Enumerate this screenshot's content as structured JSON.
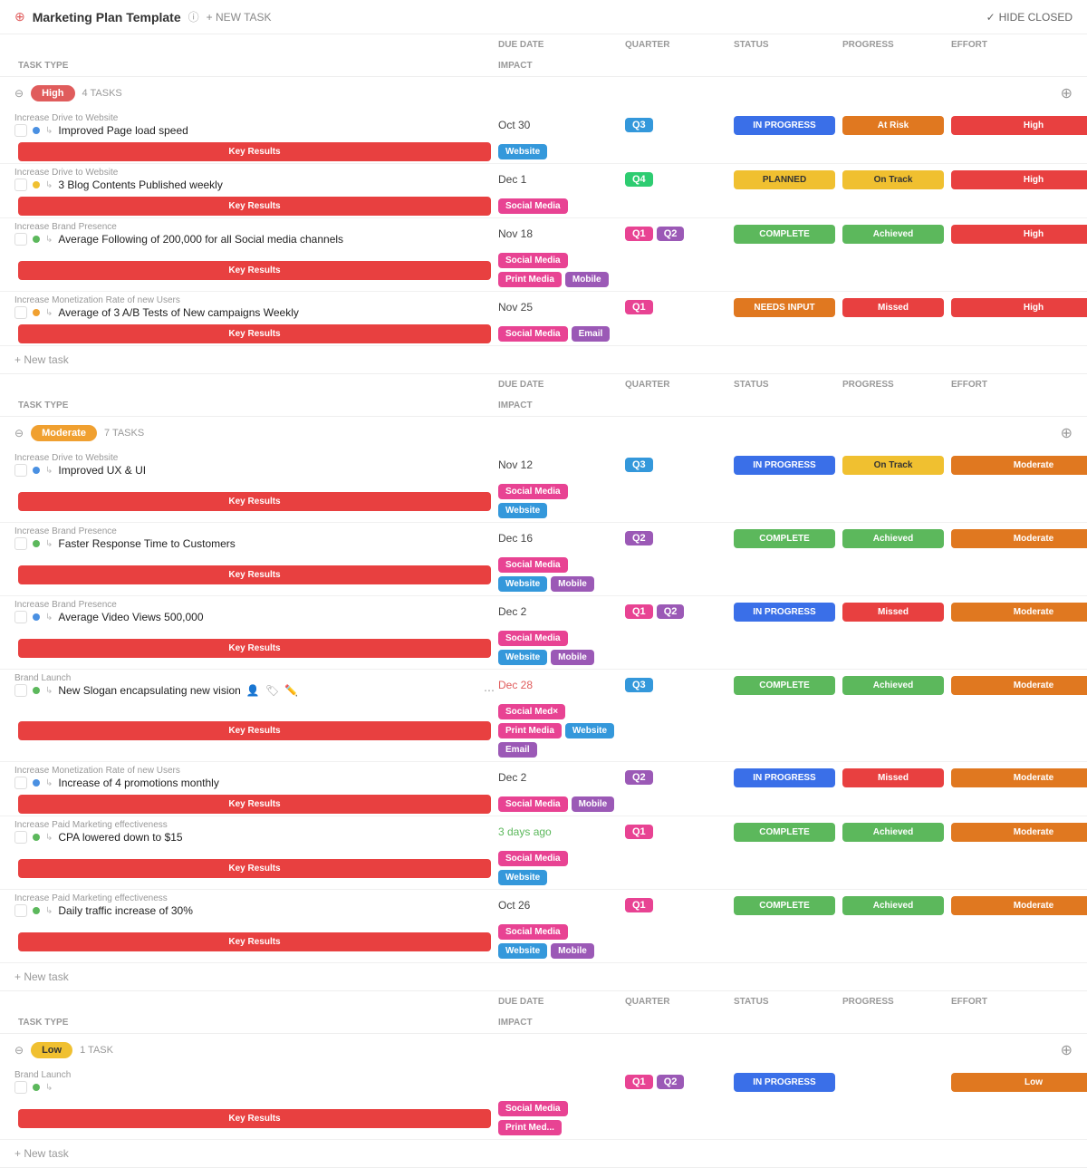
{
  "header": {
    "title": "Marketing Plan Template",
    "new_task": "+ NEW TASK",
    "hide_closed": "✓ HIDE CLOSED"
  },
  "columns": [
    "DUE DATE",
    "QUARTER",
    "STATUS",
    "PROGRESS",
    "EFFORT",
    "TASK TYPE",
    "IMPACT"
  ],
  "groups": [
    {
      "id": "high",
      "label": "High",
      "badge_class": "badge-high",
      "count": "4 TASKS",
      "tasks": [
        {
          "category": "Increase Drive to Website",
          "name": "Improved Page load speed",
          "priority": "blue",
          "due": "Oct 30",
          "quarters": [
            "Q3"
          ],
          "quarter_classes": [
            "q3"
          ],
          "status": "IN PROGRESS",
          "status_class": "status-in-progress",
          "progress": "At Risk",
          "progress_class": "prog-at-risk",
          "effort": "High",
          "effort_class": "effort-high",
          "task_type": "Key Results",
          "impact": [
            {
              "label": "Website",
              "class": "tag-website"
            }
          ]
        },
        {
          "category": "Increase Drive to Website",
          "name": "3 Blog Contents Published weekly",
          "priority": "yellow",
          "due": "Dec 1",
          "quarters": [
            "Q4"
          ],
          "quarter_classes": [
            "q4"
          ],
          "status": "PLANNED",
          "status_class": "status-planned",
          "progress": "On Track",
          "progress_class": "prog-on-track",
          "effort": "High",
          "effort_class": "effort-high",
          "task_type": "Key Results",
          "impact": [
            {
              "label": "Social Media",
              "class": "tag-social"
            }
          ]
        },
        {
          "category": "Increase Brand Presence",
          "name": "Average Following of 200,000 for all Social media channels",
          "priority": "green",
          "due": "Nov 18",
          "quarters": [
            "Q1",
            "Q2"
          ],
          "quarter_classes": [
            "q1",
            "q2"
          ],
          "status": "COMPLETE",
          "status_class": "status-complete",
          "progress": "Achieved",
          "progress_class": "prog-achieved",
          "effort": "High",
          "effort_class": "effort-high",
          "task_type": "Key Results",
          "impact": [
            {
              "label": "Social Media",
              "class": "tag-social"
            },
            {
              "label": "Print Media",
              "class": "tag-print"
            },
            {
              "label": "Mobile",
              "class": "tag-mobile"
            }
          ]
        },
        {
          "category": "Increase Monetization Rate of new Users",
          "name": "Average of 3 A/B Tests of New campaigns Weekly",
          "priority": "orange",
          "due": "Nov 25",
          "quarters": [
            "Q1"
          ],
          "quarter_classes": [
            "q1"
          ],
          "status": "NEEDS INPUT",
          "status_class": "status-needs-input",
          "progress": "Missed",
          "progress_class": "prog-missed",
          "effort": "High",
          "effort_class": "effort-high",
          "task_type": "Key Results",
          "impact": [
            {
              "label": "Social Media",
              "class": "tag-social"
            },
            {
              "label": "Email",
              "class": "tag-email"
            }
          ]
        }
      ]
    },
    {
      "id": "moderate",
      "label": "Moderate",
      "badge_class": "badge-moderate",
      "count": "7 TASKS",
      "tasks": [
        {
          "category": "Increase Drive to Website",
          "name": "Improved UX & UI",
          "priority": "blue",
          "due": "Nov 12",
          "quarters": [
            "Q3"
          ],
          "quarter_classes": [
            "q3"
          ],
          "status": "IN PROGRESS",
          "status_class": "status-in-progress",
          "progress": "On Track",
          "progress_class": "prog-on-track",
          "effort": "Moderate",
          "effort_class": "effort-moderate",
          "task_type": "Key Results",
          "impact": [
            {
              "label": "Social Media",
              "class": "tag-social"
            },
            {
              "label": "Website",
              "class": "tag-website"
            }
          ]
        },
        {
          "category": "Increase Brand Presence",
          "name": "Faster Response Time to Customers",
          "priority": "green",
          "due": "Dec 16",
          "quarters": [
            "Q2"
          ],
          "quarter_classes": [
            "q2"
          ],
          "status": "COMPLETE",
          "status_class": "status-complete",
          "progress": "Achieved",
          "progress_class": "prog-achieved",
          "effort": "Moderate",
          "effort_class": "effort-moderate",
          "task_type": "Key Results",
          "impact": [
            {
              "label": "Social Media",
              "class": "tag-social"
            },
            {
              "label": "Website",
              "class": "tag-website"
            },
            {
              "label": "Mobile",
              "class": "tag-mobile"
            }
          ]
        },
        {
          "category": "Increase Brand Presence",
          "name": "Average Video Views 500,000",
          "priority": "blue",
          "due": "Dec 2",
          "quarters": [
            "Q1",
            "Q2"
          ],
          "quarter_classes": [
            "q1",
            "q2"
          ],
          "status": "IN PROGRESS",
          "status_class": "status-in-progress",
          "progress": "Missed",
          "progress_class": "prog-missed",
          "effort": "Moderate",
          "effort_class": "effort-moderate",
          "task_type": "Key Results",
          "impact": [
            {
              "label": "Social Media",
              "class": "tag-social"
            },
            {
              "label": "Website",
              "class": "tag-website"
            },
            {
              "label": "Mobile",
              "class": "tag-mobile"
            }
          ]
        },
        {
          "category": "Brand Launch",
          "name": "New Slogan encapsulating new vision",
          "priority": "green",
          "due": "Dec 28",
          "due_class": "overdue",
          "quarters": [
            "Q3"
          ],
          "quarter_classes": [
            "q3"
          ],
          "status": "COMPLETE",
          "status_class": "status-complete",
          "progress": "Achieved",
          "progress_class": "prog-achieved",
          "effort": "Moderate",
          "effort_class": "effort-moderate",
          "task_type": "Key Results",
          "impact": [
            {
              "label": "Social Med×",
              "class": "tag-social"
            },
            {
              "label": "Print Media",
              "class": "tag-print"
            },
            {
              "label": "Website",
              "class": "tag-website"
            },
            {
              "label": "Email",
              "class": "tag-email"
            }
          ],
          "has_actions": true
        },
        {
          "category": "Increase Monetization Rate of new Users",
          "name": "Increase of 4 promotions monthly",
          "priority": "blue",
          "due": "Dec 2",
          "quarters": [
            "Q2"
          ],
          "quarter_classes": [
            "q2"
          ],
          "status": "IN PROGRESS",
          "status_class": "status-in-progress",
          "progress": "Missed",
          "progress_class": "prog-missed",
          "effort": "Moderate",
          "effort_class": "effort-moderate",
          "task_type": "Key Results",
          "impact": [
            {
              "label": "Social Media",
              "class": "tag-social"
            },
            {
              "label": "Mobile",
              "class": "tag-mobile"
            }
          ]
        },
        {
          "category": "Increase Paid Marketing effectiveness",
          "name": "CPA lowered down to $15",
          "priority": "green",
          "due": "3 days ago",
          "due_class": "soon",
          "quarters": [
            "Q1"
          ],
          "quarter_classes": [
            "q1"
          ],
          "status": "COMPLETE",
          "status_class": "status-complete",
          "progress": "Achieved",
          "progress_class": "prog-achieved",
          "effort": "Moderate",
          "effort_class": "effort-moderate",
          "task_type": "Key Results",
          "impact": [
            {
              "label": "Social Media",
              "class": "tag-social"
            },
            {
              "label": "Website",
              "class": "tag-website"
            }
          ]
        },
        {
          "category": "Increase Paid Marketing effectiveness",
          "name": "Daily traffic increase of 30%",
          "priority": "green",
          "due": "Oct 26",
          "quarters": [
            "Q1"
          ],
          "quarter_classes": [
            "q1"
          ],
          "status": "COMPLETE",
          "status_class": "status-complete",
          "progress": "Achieved",
          "progress_class": "prog-achieved",
          "effort": "Moderate",
          "effort_class": "effort-moderate",
          "task_type": "Key Results",
          "impact": [
            {
              "label": "Social Media",
              "class": "tag-social"
            },
            {
              "label": "Website",
              "class": "tag-website"
            },
            {
              "label": "Mobile",
              "class": "tag-mobile"
            }
          ]
        }
      ]
    },
    {
      "id": "low",
      "label": "Low",
      "badge_class": "badge-low",
      "count": "1 TASK",
      "tasks": [
        {
          "category": "Brand Launch",
          "name": "",
          "priority": "green",
          "due": "",
          "quarters": [
            "Q1",
            "Q2"
          ],
          "quarter_classes": [
            "q1",
            "q2"
          ],
          "status": "IN PROGRESS",
          "status_class": "status-in-progress",
          "progress": "",
          "progress_class": "",
          "effort": "Low",
          "effort_class": "effort-moderate",
          "task_type": "Key Results",
          "impact": [
            {
              "label": "Social Media",
              "class": "tag-social"
            },
            {
              "label": "Print Med...",
              "class": "tag-print"
            }
          ],
          "is_partial": true
        }
      ]
    }
  ],
  "add_task_label": "+ New task",
  "priority_colors": {
    "blue": "#4a90e2",
    "yellow": "#f0c030",
    "green": "#5cb85c",
    "orange": "#f0a030"
  }
}
